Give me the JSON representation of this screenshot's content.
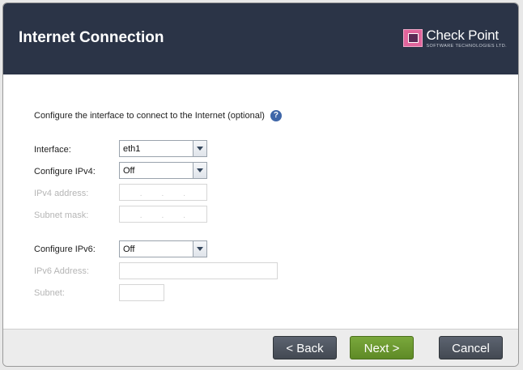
{
  "header": {
    "title": "Internet Connection",
    "logo_name": "Check Point",
    "logo_subtitle": "SOFTWARE TECHNOLOGIES LTD."
  },
  "main": {
    "description": "Configure the interface to connect to the Internet (optional)",
    "interface_label": "Interface:",
    "interface_value": "eth1",
    "ipv4_label": "Configure IPv4:",
    "ipv4_value": "Off",
    "ipv4_address_label": "IPv4 address:",
    "subnet_mask_label": "Subnet mask:",
    "ipv6_label": "Configure IPv6:",
    "ipv6_value": "Off",
    "ipv6_address_label": "IPv6 Address:",
    "subnet_label": "Subnet:"
  },
  "footer": {
    "back_label": "< Back",
    "next_label": "Next >",
    "cancel_label": "Cancel"
  },
  "colors": {
    "header_bg": "#2b3447",
    "next_button": "#6b9630",
    "secondary_button": "#4f5560",
    "help_icon": "#3f66a8",
    "logo_accent": "#e0659c"
  },
  "icons": {
    "help": "question-circle-icon",
    "dropdown": "chevron-down-icon",
    "logo": "checkpoint-logo-icon"
  }
}
